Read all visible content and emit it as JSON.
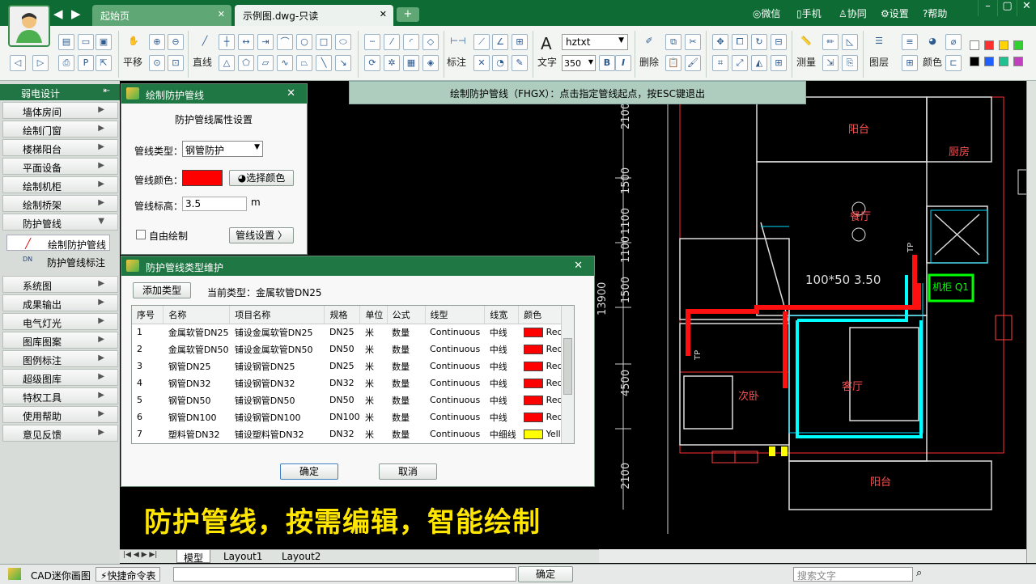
{
  "tabs": [
    {
      "label": "起始页"
    },
    {
      "label": "示例图.dwg-只读"
    }
  ],
  "tab_add": "+",
  "right_links": {
    "weixin": "微信",
    "phone": "手机",
    "collab": "协同",
    "settings": "设置",
    "help": "帮助"
  },
  "toolbar": {
    "pan": "平移",
    "line": "直线",
    "dim": "标注",
    "text": "文字",
    "font": "hztxt",
    "fontsize": "350",
    "bold": "B",
    "italic": "I",
    "erase": "删除",
    "measure": "测量",
    "layer": "图层",
    "color": "颜色"
  },
  "sidebar": {
    "header": "弱电设计",
    "items": [
      "墙体房间",
      "绘制门窗",
      "楼梯阳台",
      "平面设备",
      "绘制机柜",
      "绘制桥架",
      "防护管线"
    ],
    "subitems": [
      "绘制防护管线",
      "防护管线标注"
    ],
    "items2": [
      "系统图",
      "成果输出",
      "电气灯光",
      "图库图案",
      "图例标注",
      "超级图库",
      "特权工具",
      "使用帮助",
      "意见反馈"
    ]
  },
  "hint": "绘制防护管线（FHGX）：点击指定管线起点，按ESC键退出",
  "dlg1": {
    "title": "绘制防护管线",
    "section": "防护管线属性设置",
    "type_label": "管线类型：",
    "type_value": "钢管防护",
    "color_label": "管线颜色：",
    "choose_color": "选择颜色",
    "elev_label": "管线标高：",
    "elev_value": "3.5",
    "unit": "m",
    "free_draw": "自由绘制",
    "settings": "管线设置 〉"
  },
  "dlg2": {
    "title": "防护管线类型维护",
    "add_type": "添加类型",
    "current": "当前类型：金属软管DN25",
    "headers": [
      "序号",
      "名称",
      "项目名称",
      "规格",
      "单位",
      "公式",
      "线型",
      "线宽",
      "颜色"
    ],
    "rows": [
      [
        "1",
        "金属软管DN25",
        "铺设金属软管DN25",
        "DN25",
        "米",
        "数量",
        "Continuous",
        "中线",
        "Red"
      ],
      [
        "2",
        "金属软管DN50",
        "铺设金属软管DN50",
        "DN50",
        "米",
        "数量",
        "Continuous",
        "中线",
        "Red"
      ],
      [
        "3",
        "钢管DN25",
        "铺设钢管DN25",
        "DN25",
        "米",
        "数量",
        "Continuous",
        "中线",
        "Red"
      ],
      [
        "4",
        "钢管DN32",
        "铺设钢管DN32",
        "DN32",
        "米",
        "数量",
        "Continuous",
        "中线",
        "Red"
      ],
      [
        "5",
        "钢管DN50",
        "铺设钢管DN50",
        "DN50",
        "米",
        "数量",
        "Continuous",
        "中线",
        "Red"
      ],
      [
        "6",
        "钢管DN100",
        "铺设钢管DN100",
        "DN100",
        "米",
        "数量",
        "Continuous",
        "中线",
        "Red"
      ],
      [
        "7",
        "塑料管DN32",
        "铺设塑料管DN32",
        "DN32",
        "米",
        "数量",
        "Continuous",
        "中细线",
        "Yellow"
      ]
    ],
    "row_colors": [
      "#ff0000",
      "#ff0000",
      "#ff0000",
      "#ff0000",
      "#ff0000",
      "#ff0000",
      "#ffff00"
    ],
    "ok": "确定",
    "cancel": "取消"
  },
  "slogan": "防护管线，按需编辑，智能绘制",
  "cad": {
    "rooms": {
      "balcony1": "阳台",
      "kitchen": "厨房",
      "dining": "餐厅",
      "cabinet": "机柜 Q1",
      "bedroom": "次卧",
      "living": "客厅",
      "balcony2": "阳台"
    },
    "dims": [
      "2100",
      "1500",
      "1100",
      "1100",
      "1500",
      "4500",
      "2100"
    ],
    "total": "13900",
    "pipe_label": "100*50    3.50",
    "tp": "TP"
  },
  "layouts": [
    "模型",
    "Layout1",
    "Layout2"
  ],
  "status": {
    "app": "CAD迷你画图",
    "quick": "快捷命令表",
    "confirm": "确定",
    "search": "搜索文字"
  }
}
